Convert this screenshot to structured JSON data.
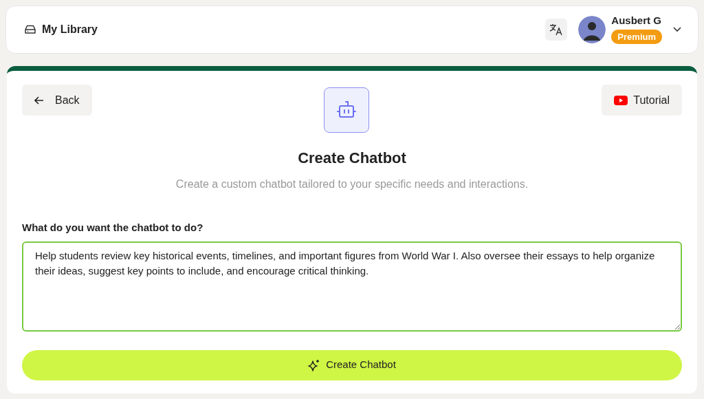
{
  "header": {
    "library_label": "My Library",
    "user": {
      "name": "Ausbert G",
      "badge": "Premium"
    }
  },
  "card": {
    "back_button": "Back",
    "tutorial_button": "Tutorial",
    "title": "Create Chatbot",
    "subtitle": "Create a custom chatbot tailored to your specific needs and interactions.",
    "field": {
      "label": "What do you want the chatbot to do?",
      "value": "Help students review key historical events, timelines, and important figures from World War I. Also oversee their essays to help organize their ideas, suggest key points to include, and encourage critical thinking."
    },
    "submit_button": "Create Chatbot"
  }
}
